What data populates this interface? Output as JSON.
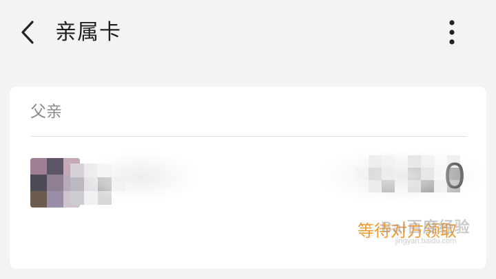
{
  "header": {
    "title": "亲属卡",
    "back_icon": "chevron-left-icon",
    "more_icon": "more-vertical-icon"
  },
  "card": {
    "relation": "父亲",
    "amount_tail": "0",
    "status_link": "等待对方领取",
    "status_color": "#f0992d"
  },
  "watermark": {
    "main": "Bai百度经验",
    "sub": "jingyan.baidu.com"
  }
}
